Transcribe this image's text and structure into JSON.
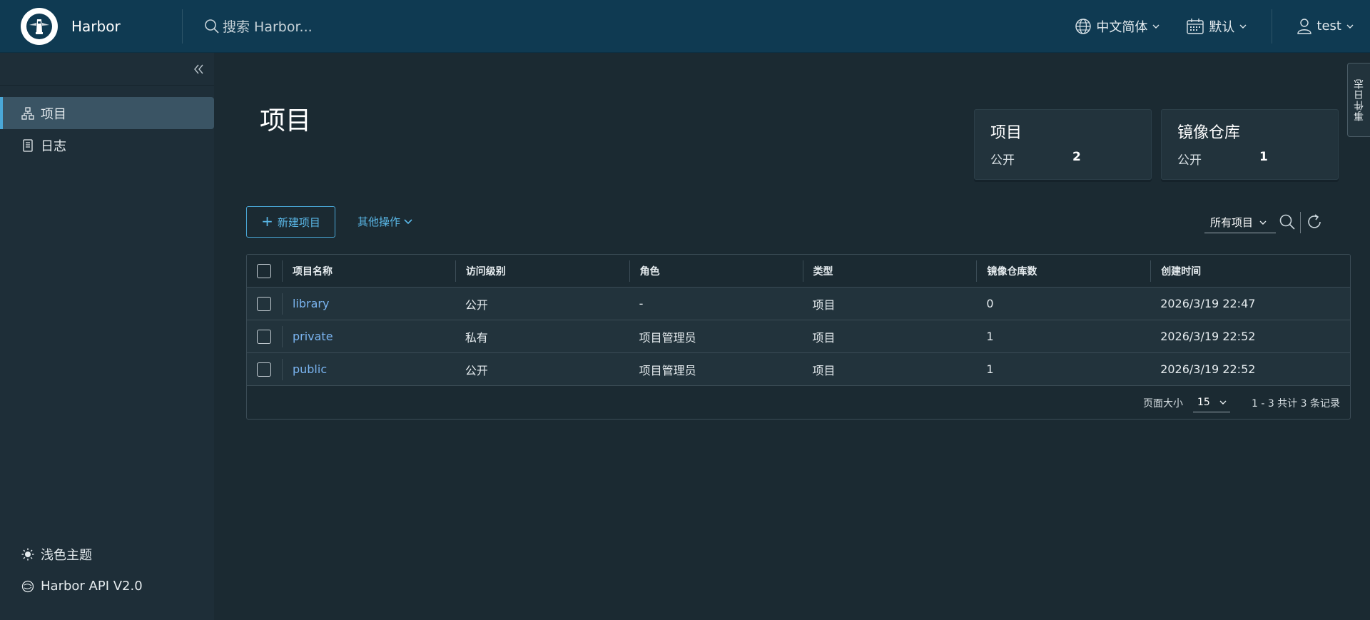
{
  "header": {
    "brand": "Harbor",
    "search_placeholder": "搜索 Harbor...",
    "language": "中文简体",
    "datetime": "默认",
    "user": "test"
  },
  "sidebar": {
    "items": [
      {
        "label": "项目",
        "icon": "projects-icon",
        "active": true
      },
      {
        "label": "日志",
        "icon": "log-icon",
        "active": false
      }
    ],
    "bottom": [
      {
        "label": "浅色主题",
        "icon": "sun-icon"
      },
      {
        "label": "Harbor API V2.0",
        "icon": "api-icon"
      }
    ]
  },
  "main": {
    "title": "项目",
    "cards": [
      {
        "title": "项目",
        "label": "公开",
        "value": "2"
      },
      {
        "title": "镜像仓库",
        "label": "公开",
        "value": "1"
      }
    ],
    "new_project": "新建项目",
    "other_actions": "其他操作",
    "filter": "所有项目"
  },
  "table": {
    "headers": [
      "项目名称",
      "访问级别",
      "角色",
      "类型",
      "镜像仓库数",
      "创建时间"
    ],
    "rows": [
      {
        "name": "library",
        "access": "公开",
        "role": "-",
        "type": "项目",
        "repos": "0",
        "created": "2026/3/19 22:47"
      },
      {
        "name": "private",
        "access": "私有",
        "role": "项目管理员",
        "type": "项目",
        "repos": "1",
        "created": "2026/3/19 22:52"
      },
      {
        "name": "public",
        "access": "公开",
        "role": "项目管理员",
        "type": "项目",
        "repos": "1",
        "created": "2026/3/19 22:52"
      }
    ],
    "footer": {
      "page_size_label": "页面大小",
      "page_size": "15",
      "summary": "1 - 3 共计 3 条记录"
    }
  },
  "side_tab": "事件日志",
  "colors": {
    "header_bg": "#0f3a52",
    "sidebar_bg": "#1e2e38",
    "accent": "#4aa8d8",
    "link": "#7ab4f0"
  }
}
